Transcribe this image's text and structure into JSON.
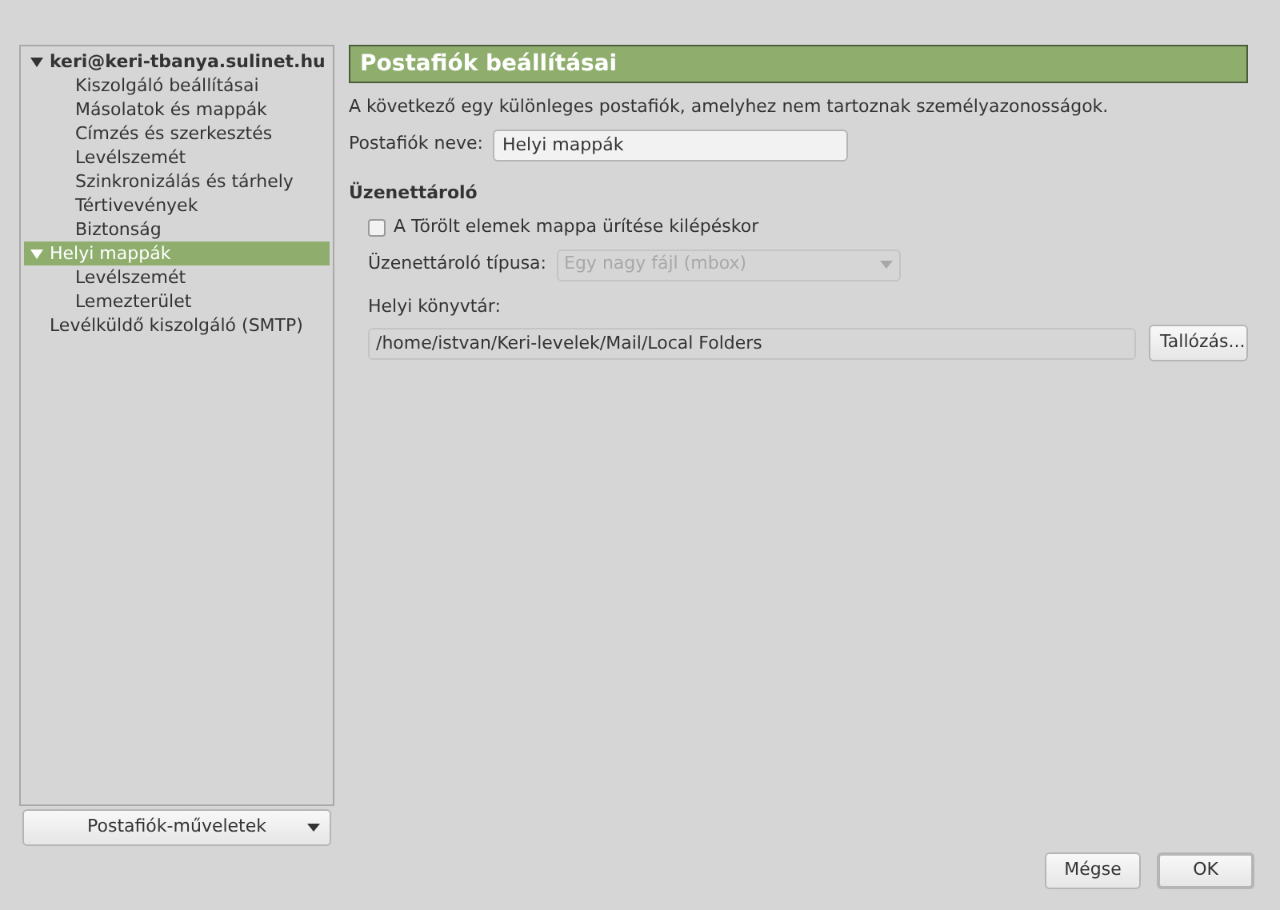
{
  "tree": [
    {
      "label": "keri@keri-tbanya.sulinet.hu",
      "bold": true,
      "expanded": true,
      "selected": false,
      "children": [
        {
          "label": "Kiszolgáló beállításai",
          "selected": false
        },
        {
          "label": "Másolatok és mappák",
          "selected": false
        },
        {
          "label": "Címzés és szerkesztés",
          "selected": false
        },
        {
          "label": "Levélszemét",
          "selected": false
        },
        {
          "label": "Szinkronizálás és tárhely",
          "selected": false
        },
        {
          "label": "Tértivevények",
          "selected": false
        },
        {
          "label": "Biztonság",
          "selected": false
        }
      ]
    },
    {
      "label": "Helyi mappák",
      "bold": false,
      "expanded": true,
      "selected": true,
      "children": [
        {
          "label": "Levélszemét",
          "selected": false
        },
        {
          "label": "Lemezterület",
          "selected": false
        }
      ]
    },
    {
      "label": "Levélküldő kiszolgáló (SMTP)",
      "bold": false,
      "selected": false
    }
  ],
  "account_actions": "Postafiók-műveletek",
  "header": "Postafiók beállításai",
  "description": "A következő egy különleges postafiók, amelyhez nem tartoznak személyazonosságok.",
  "account_name": {
    "label": "Postafiók neve:",
    "value": "Helyi mappák"
  },
  "storage": {
    "title": "Üzenettároló",
    "empty_trash": {
      "label": "A Törölt elemek mappa ürítése kilépéskor",
      "checked": false
    },
    "store_type": {
      "label": "Üzenettároló típusa:",
      "value": "Egy nagy fájl (mbox)",
      "disabled": true
    },
    "local_dir": {
      "label": "Helyi könyvtár:",
      "value": "/home/istvan/Keri-levelek/Mail/Local Folders",
      "browse": "Tallózás..."
    }
  },
  "buttons": [
    {
      "label": "Mégse",
      "default": false
    },
    {
      "label": "OK",
      "default": true
    }
  ]
}
